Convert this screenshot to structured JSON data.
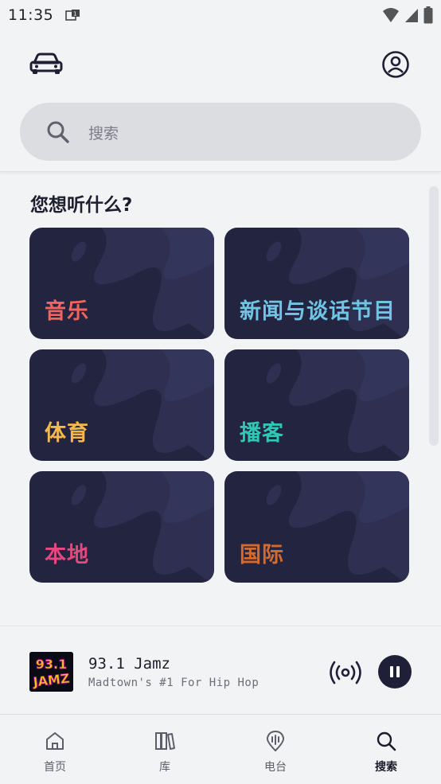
{
  "status_bar": {
    "time": "11:35"
  },
  "header": {
    "car_mode_icon": "car-icon",
    "account_icon": "account-circle-icon"
  },
  "search": {
    "placeholder": "搜索",
    "icon": "search-icon"
  },
  "browse": {
    "heading": "您想听什么?",
    "categories": [
      {
        "label": "音乐",
        "color": "#f0655e"
      },
      {
        "label": "新闻与谈话节目",
        "color": "#6fc5e3"
      },
      {
        "label": "体育",
        "color": "#f5b84a"
      },
      {
        "label": "播客",
        "color": "#2ec8b4"
      },
      {
        "label": "本地",
        "color": "#e2497e"
      },
      {
        "label": "国际",
        "color": "#d66a2c"
      }
    ]
  },
  "now_playing": {
    "station_name": "93.1 Jamz",
    "tagline": "Madtown's #1 For Hip Hop",
    "logo_text_top": "93.1",
    "logo_text_bottom": "JAMZ",
    "live_icon": "live-broadcast-icon",
    "control_icon": "pause-icon"
  },
  "bottom_nav": {
    "items": [
      {
        "label": "首页",
        "icon": "home-icon",
        "active": false
      },
      {
        "label": "库",
        "icon": "library-icon",
        "active": false
      },
      {
        "label": "电台",
        "icon": "radio-icon",
        "active": false
      },
      {
        "label": "搜索",
        "icon": "search-icon",
        "active": true
      }
    ]
  }
}
